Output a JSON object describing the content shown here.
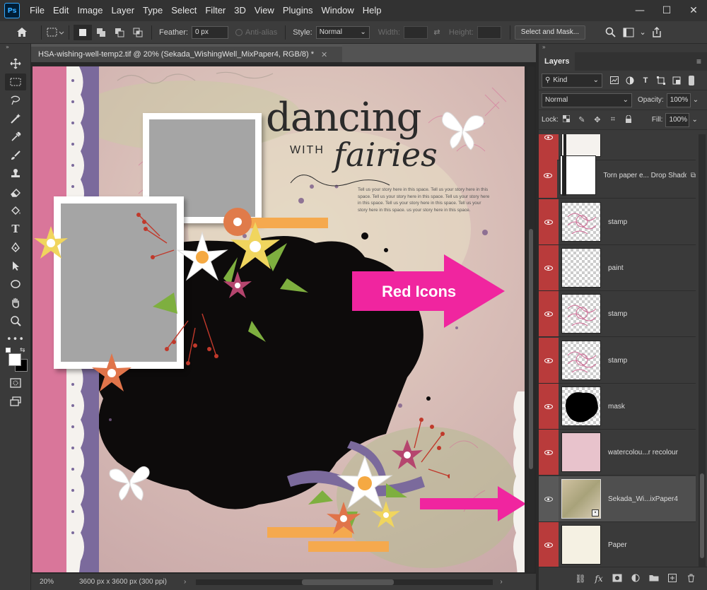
{
  "app": {
    "logo": "Ps"
  },
  "menu": [
    "File",
    "Edit",
    "Image",
    "Layer",
    "Type",
    "Select",
    "Filter",
    "3D",
    "View",
    "Plugins",
    "Window",
    "Help"
  ],
  "window_controls": {
    "minimize": "—",
    "maximize": "☐",
    "close": "✕"
  },
  "options_bar": {
    "feather_label": "Feather:",
    "feather_value": "0 px",
    "antialias_label": "Anti-alias",
    "style_label": "Style:",
    "style_value": "Normal",
    "width_label": "Width:",
    "height_label": "Height:",
    "select_mask_label": "Select and Mask..."
  },
  "document": {
    "tab_title": "HSA-wishing-well-temp2.tif @ 20% (Sekada_WishingWell_MixPaper4, RGB/8) *",
    "tab_close": "✕"
  },
  "canvas": {
    "title_line1": "dancing",
    "title_with": "WITH",
    "title_line2": "fairies",
    "story_text": "Tell us your story here in this space. Tell us your story here in this space. Tell us your story here in this space. Tell us your story here in this space. Tell us your story here in this space. Tell us your story here in this space. us your story here in this space.",
    "annotation_label": "Red Icons",
    "colors": {
      "annotation": "#f0259f",
      "pink_strip": "#d9769a",
      "purple_strip": "#7b6a9c"
    }
  },
  "status_bar": {
    "zoom": "20%",
    "doc_size": "3600 px x 3600 px (300 ppi)",
    "arrow": "›"
  },
  "layers_panel": {
    "collapse": "»",
    "tab": "Layers",
    "menu_icon": "≡",
    "kind_filter": "Kind",
    "blend_mode": "Normal",
    "opacity_label": "Opacity:",
    "opacity_value": "100%",
    "lock_label": "Lock:",
    "fill_label": "Fill:",
    "fill_value": "100%",
    "eye_color": "#b93b3b",
    "layers": [
      {
        "name": "",
        "thumb": "partial",
        "visible": true,
        "selected": false
      },
      {
        "name": "Torn paper e... Drop Shadow",
        "thumb": "torn",
        "visible": true,
        "selected": false
      },
      {
        "name": "stamp",
        "thumb": "stamp",
        "visible": true,
        "selected": false
      },
      {
        "name": "paint",
        "thumb": "paint",
        "visible": true,
        "selected": false
      },
      {
        "name": "stamp",
        "thumb": "stamp",
        "visible": true,
        "selected": false
      },
      {
        "name": "stamp",
        "thumb": "stamp",
        "visible": true,
        "selected": false
      },
      {
        "name": "mask",
        "thumb": "mask",
        "visible": true,
        "selected": false
      },
      {
        "name": "watercolou...r recolour",
        "thumb": "watercolour",
        "visible": true,
        "selected": false
      },
      {
        "name": "Sekada_Wi...ixPaper4",
        "thumb": "paper4",
        "visible": true,
        "selected": true
      },
      {
        "name": "Paper",
        "thumb": "paper",
        "visible": true,
        "selected": false
      }
    ]
  }
}
